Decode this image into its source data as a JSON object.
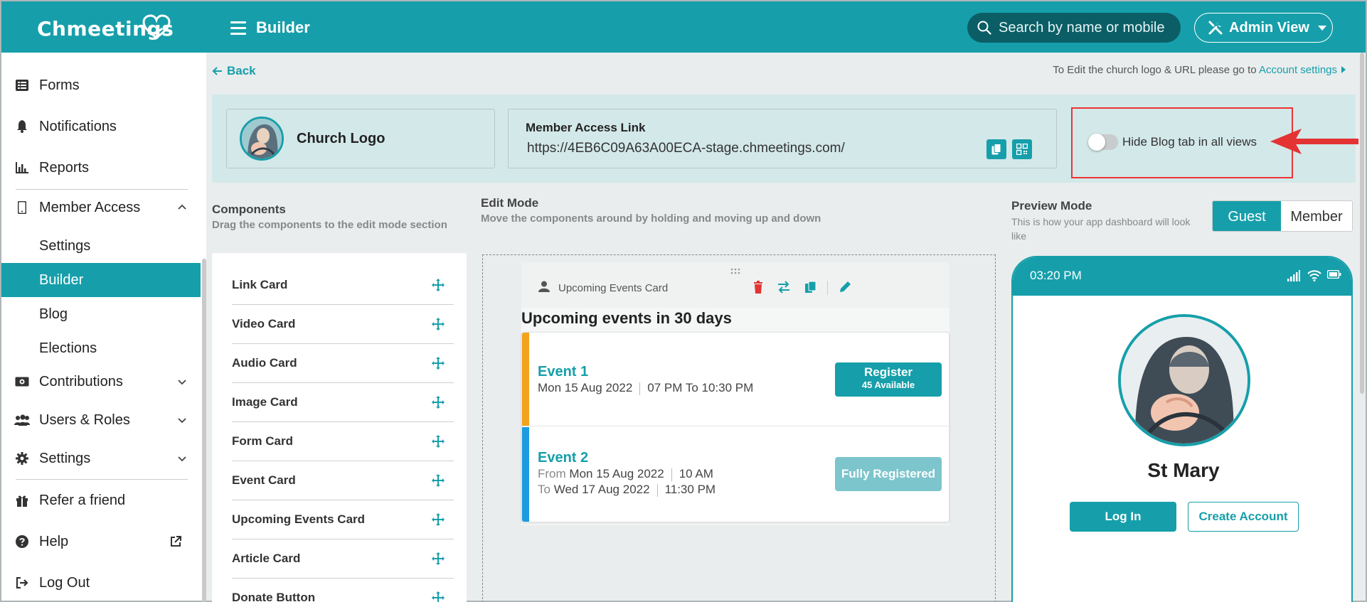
{
  "app": {
    "name": "Chmeetings",
    "page_title": "Builder"
  },
  "header": {
    "search_placeholder": "Search by name or mobile",
    "view_label": "Admin View"
  },
  "sidebar": {
    "items": [
      {
        "label": "Forms"
      },
      {
        "label": "Notifications"
      },
      {
        "label": "Reports"
      },
      {
        "label": "Member Access"
      },
      {
        "label": "Contributions"
      },
      {
        "label": "Users & Roles"
      },
      {
        "label": "Settings"
      },
      {
        "label": "Refer a friend"
      },
      {
        "label": "Help"
      },
      {
        "label": "Log Out"
      }
    ],
    "sub_items": [
      "Settings",
      "Builder",
      "Blog",
      "Elections"
    ],
    "active_sub": "Builder"
  },
  "main": {
    "back_label": "Back",
    "edit_note": "To Edit the church logo & URL please go to",
    "account_settings_link": "Account settings",
    "church_logo_label": "Church Logo",
    "member_access_title": "Member Access Link",
    "member_access_url": "https://4EB6C09A63A00ECA-stage.chmeetings.com/",
    "hide_blog_label": "Hide Blog tab in all views",
    "hide_blog_enabled": false
  },
  "components": {
    "title": "Components",
    "subtitle": "Drag the components to the edit mode section",
    "items": [
      "Link Card",
      "Video Card",
      "Audio Card",
      "Image Card",
      "Form Card",
      "Event Card",
      "Upcoming Events Card",
      "Article Card",
      "Donate Button"
    ]
  },
  "edit_mode": {
    "title": "Edit Mode",
    "subtitle": "Move the components around by holding and moving up and down",
    "card_name": "Upcoming Events Card",
    "heading": "Upcoming events in 30 days",
    "events": [
      {
        "title": "Event 1",
        "date": "Mon 15 Aug  2022",
        "time": "07 PM To 10:30 PM",
        "button": "Register",
        "availability": "45 Available",
        "color": "#f3a31c"
      },
      {
        "title": "Event 2",
        "from_label": "From",
        "from_date": "Mon 15 Aug  2022",
        "from_time": "10 AM",
        "to_label": "To",
        "to_date": "Wed 17 Aug  2022",
        "to_time": "11:30 PM",
        "button": "Fully Registered",
        "color": "#1c9be0"
      }
    ]
  },
  "preview": {
    "title": "Preview Mode",
    "subtitle": "This is how your app dashboard will look like",
    "toggle": [
      "Guest",
      "Member"
    ],
    "active_toggle": "Guest",
    "time": "03:20 PM",
    "church_name": "St Mary",
    "login_label": "Log In",
    "create_account_label": "Create Account"
  },
  "colors": {
    "primary": "#169faa",
    "highlight": "#e33333",
    "event1": "#f3a31c",
    "event2": "#1c9be0"
  }
}
